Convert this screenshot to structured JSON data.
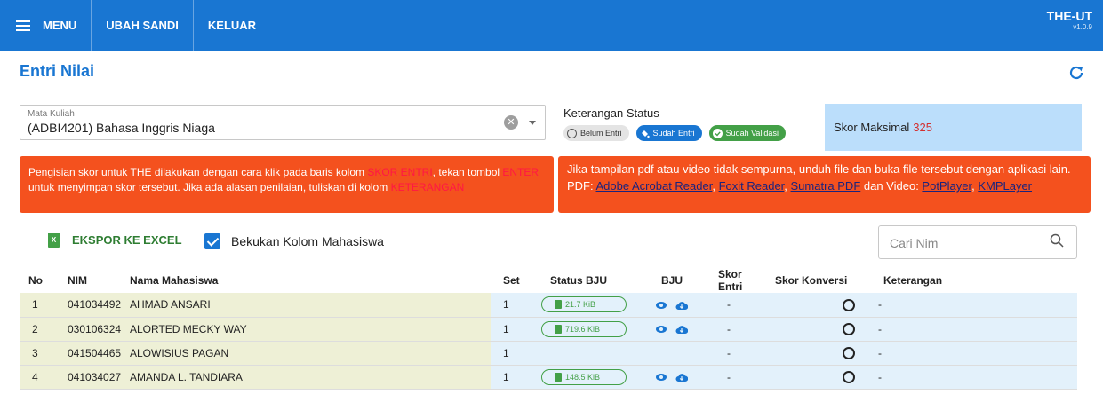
{
  "topbar": {
    "menu_label": "MENU",
    "change_password_label": "UBAH SANDI",
    "logout_label": "KELUAR",
    "brand": "THE-UT",
    "version": "v1.0.9"
  },
  "page": {
    "title": "Entri Nilai"
  },
  "course": {
    "label": "Mata Kuliah",
    "value": "(ADBI4201) Bahasa Inggris Niaga"
  },
  "status_legend": {
    "heading": "Keterangan Status",
    "belum": "Belum Entri",
    "sudah": "Sudah Entri",
    "valid": "Sudah Validasi"
  },
  "max_score": {
    "label": "Skor Maksimal",
    "value": "325"
  },
  "note_left": {
    "t1": "Pengisian skor untuk THE dilakukan dengan cara klik pada baris kolom ",
    "h1": "SKOR ENTRI",
    "t2": ", tekan tombol ",
    "h2": "ENTER",
    "t3": " untuk menyimpan skor tersebut. Jika ada alasan penilaian, tuliskan di kolom ",
    "h3": "KETERANGAN"
  },
  "note_right": {
    "line1": "Jika tampilan pdf atau video tidak sempurna, unduh file dan buka file tersebut dengan aplikasi lain.",
    "pdf_label": "PDF: ",
    "link1": "Adobe Acrobat Reader",
    "link2": "Foxit Reader",
    "link3": "Sumatra PDF",
    "video_label": " dan Video: ",
    "link4": "PotPlayer",
    "link5": "KMPLayer",
    "sep": ", "
  },
  "toolbar": {
    "export_label": "EKSPOR KE EXCEL",
    "freeze_label": "Bekukan Kolom Mahasiswa",
    "search_placeholder": "Cari Nim"
  },
  "table": {
    "headers": {
      "no": "No",
      "nim": "NIM",
      "nama": "Nama Mahasiswa",
      "set": "Set",
      "status_bju": "Status BJU",
      "bju": "BJU",
      "skor_entri": "Skor Entri",
      "skor_konversi": "Skor Konversi",
      "keterangan": "Keterangan"
    },
    "rows": [
      {
        "no": "1",
        "nim": "041034492",
        "nama": "AHMAD ANSARI",
        "set": "1",
        "size": "21.7 KiB",
        "skor": "-",
        "ket": "-"
      },
      {
        "no": "2",
        "nim": "030106324",
        "nama": "ALORTED MECKY WAY",
        "set": "1",
        "size": "719.6 KiB",
        "skor": "-",
        "ket": "-"
      },
      {
        "no": "3",
        "nim": "041504465",
        "nama": "ALOWISIUS PAGAN",
        "set": "1",
        "size": "",
        "skor": "-",
        "ket": "-"
      },
      {
        "no": "4",
        "nim": "041034027",
        "nama": "AMANDA L. TANDIARA",
        "set": "1",
        "size": "148.5 KiB",
        "skor": "-",
        "ket": "-"
      }
    ]
  }
}
